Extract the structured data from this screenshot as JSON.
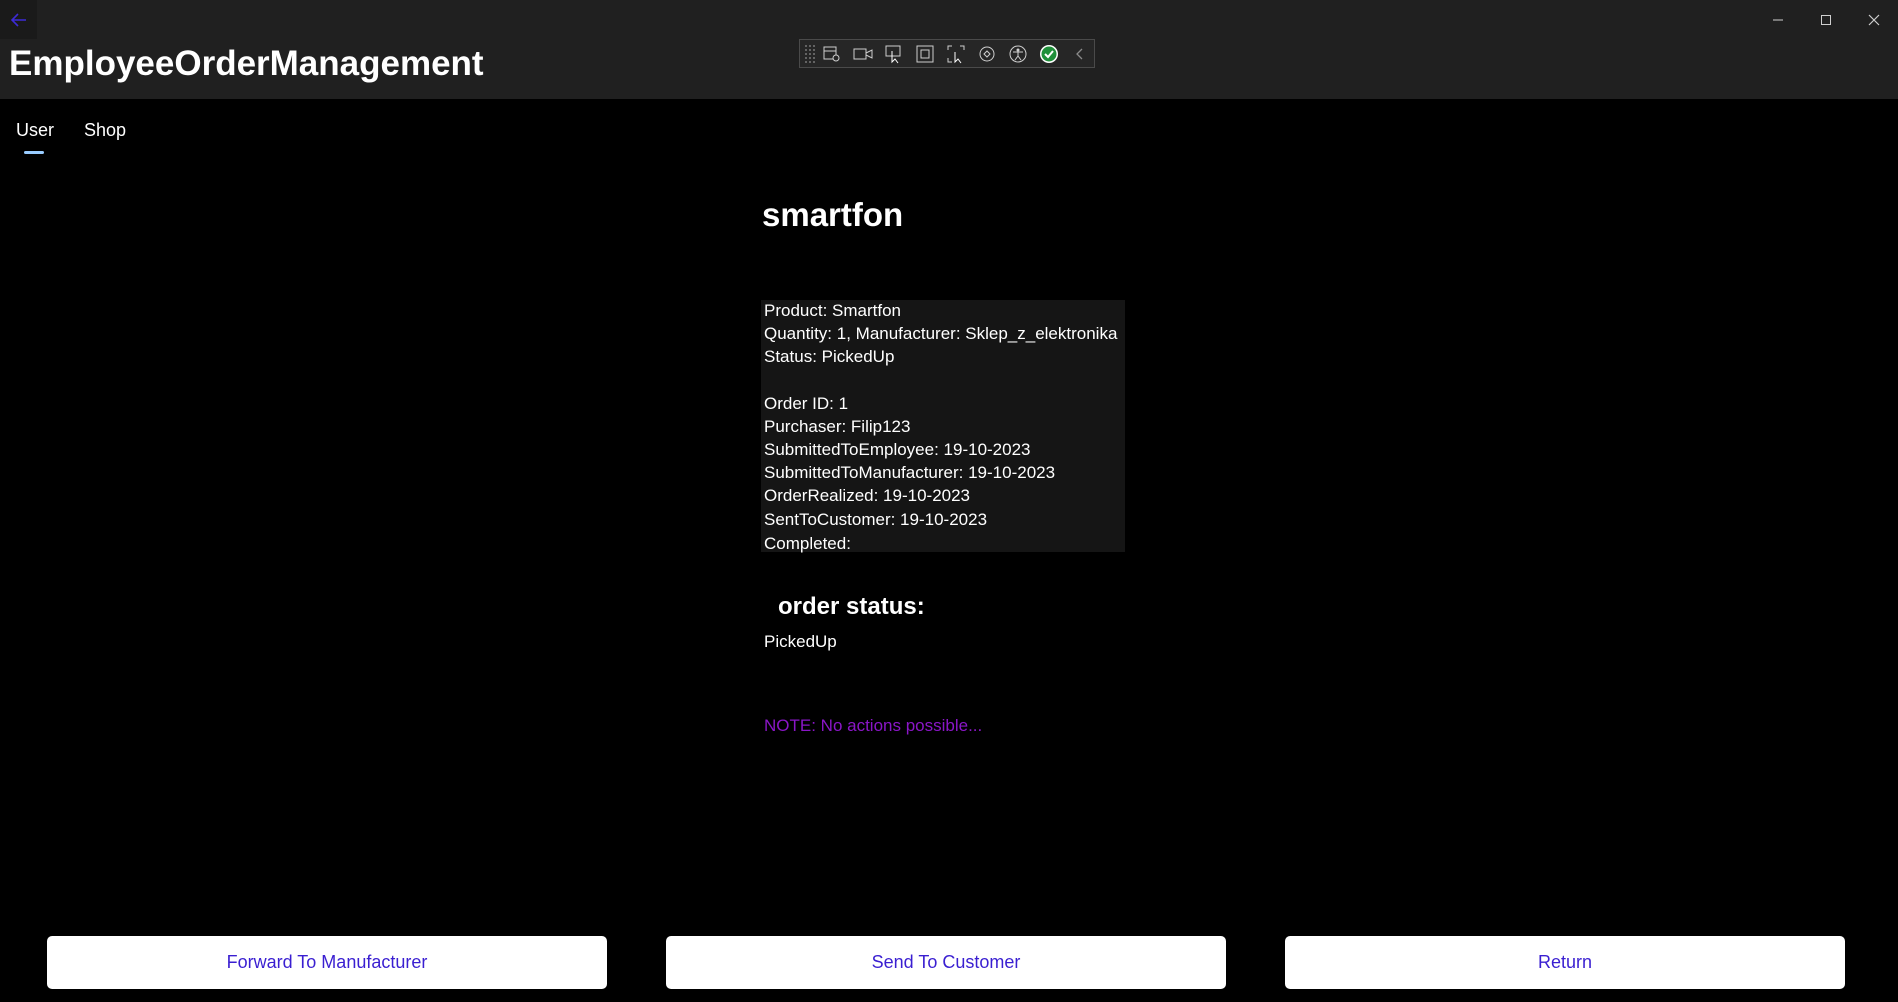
{
  "app": {
    "title": "EmployeeOrderManagement"
  },
  "nav": {
    "tabs": [
      {
        "label": "User",
        "selected": true
      },
      {
        "label": "Shop",
        "selected": false
      }
    ]
  },
  "debug_toolbar": {
    "icons": [
      "live-visual-tree-icon",
      "record-icon",
      "select-element-icon",
      "display-layout-adorners-icon",
      "track-focus-icon",
      "hot-reload-icon",
      "accessibility-icon",
      "check-icon",
      "collapse-icon"
    ]
  },
  "order": {
    "product_title": "smartfon",
    "details": [
      "Product: Smartfon",
      "Quantity: 1, Manufacturer: Sklep_z_elektronika",
      "Status: PickedUp",
      "",
      "Order ID: 1",
      "Purchaser: Filip123",
      "SubmittedToEmployee: 19-10-2023",
      "SubmittedToManufacturer: 19-10-2023",
      "OrderRealized: 19-10-2023",
      "SentToCustomer: 19-10-2023",
      "Completed:"
    ],
    "status_heading": "order status:",
    "status_value": "PickedUp",
    "note": "NOTE: No actions possible..."
  },
  "actions": {
    "forward_label": "Forward To Manufacturer",
    "send_label": "Send To Customer",
    "return_label": "Return"
  },
  "colors": {
    "background": "#000000",
    "header": "#202020",
    "accent_nav": "#99ccff",
    "button_text": "#3a1fd1",
    "note": "#8a16c7",
    "button_bg": "#ffffff"
  }
}
